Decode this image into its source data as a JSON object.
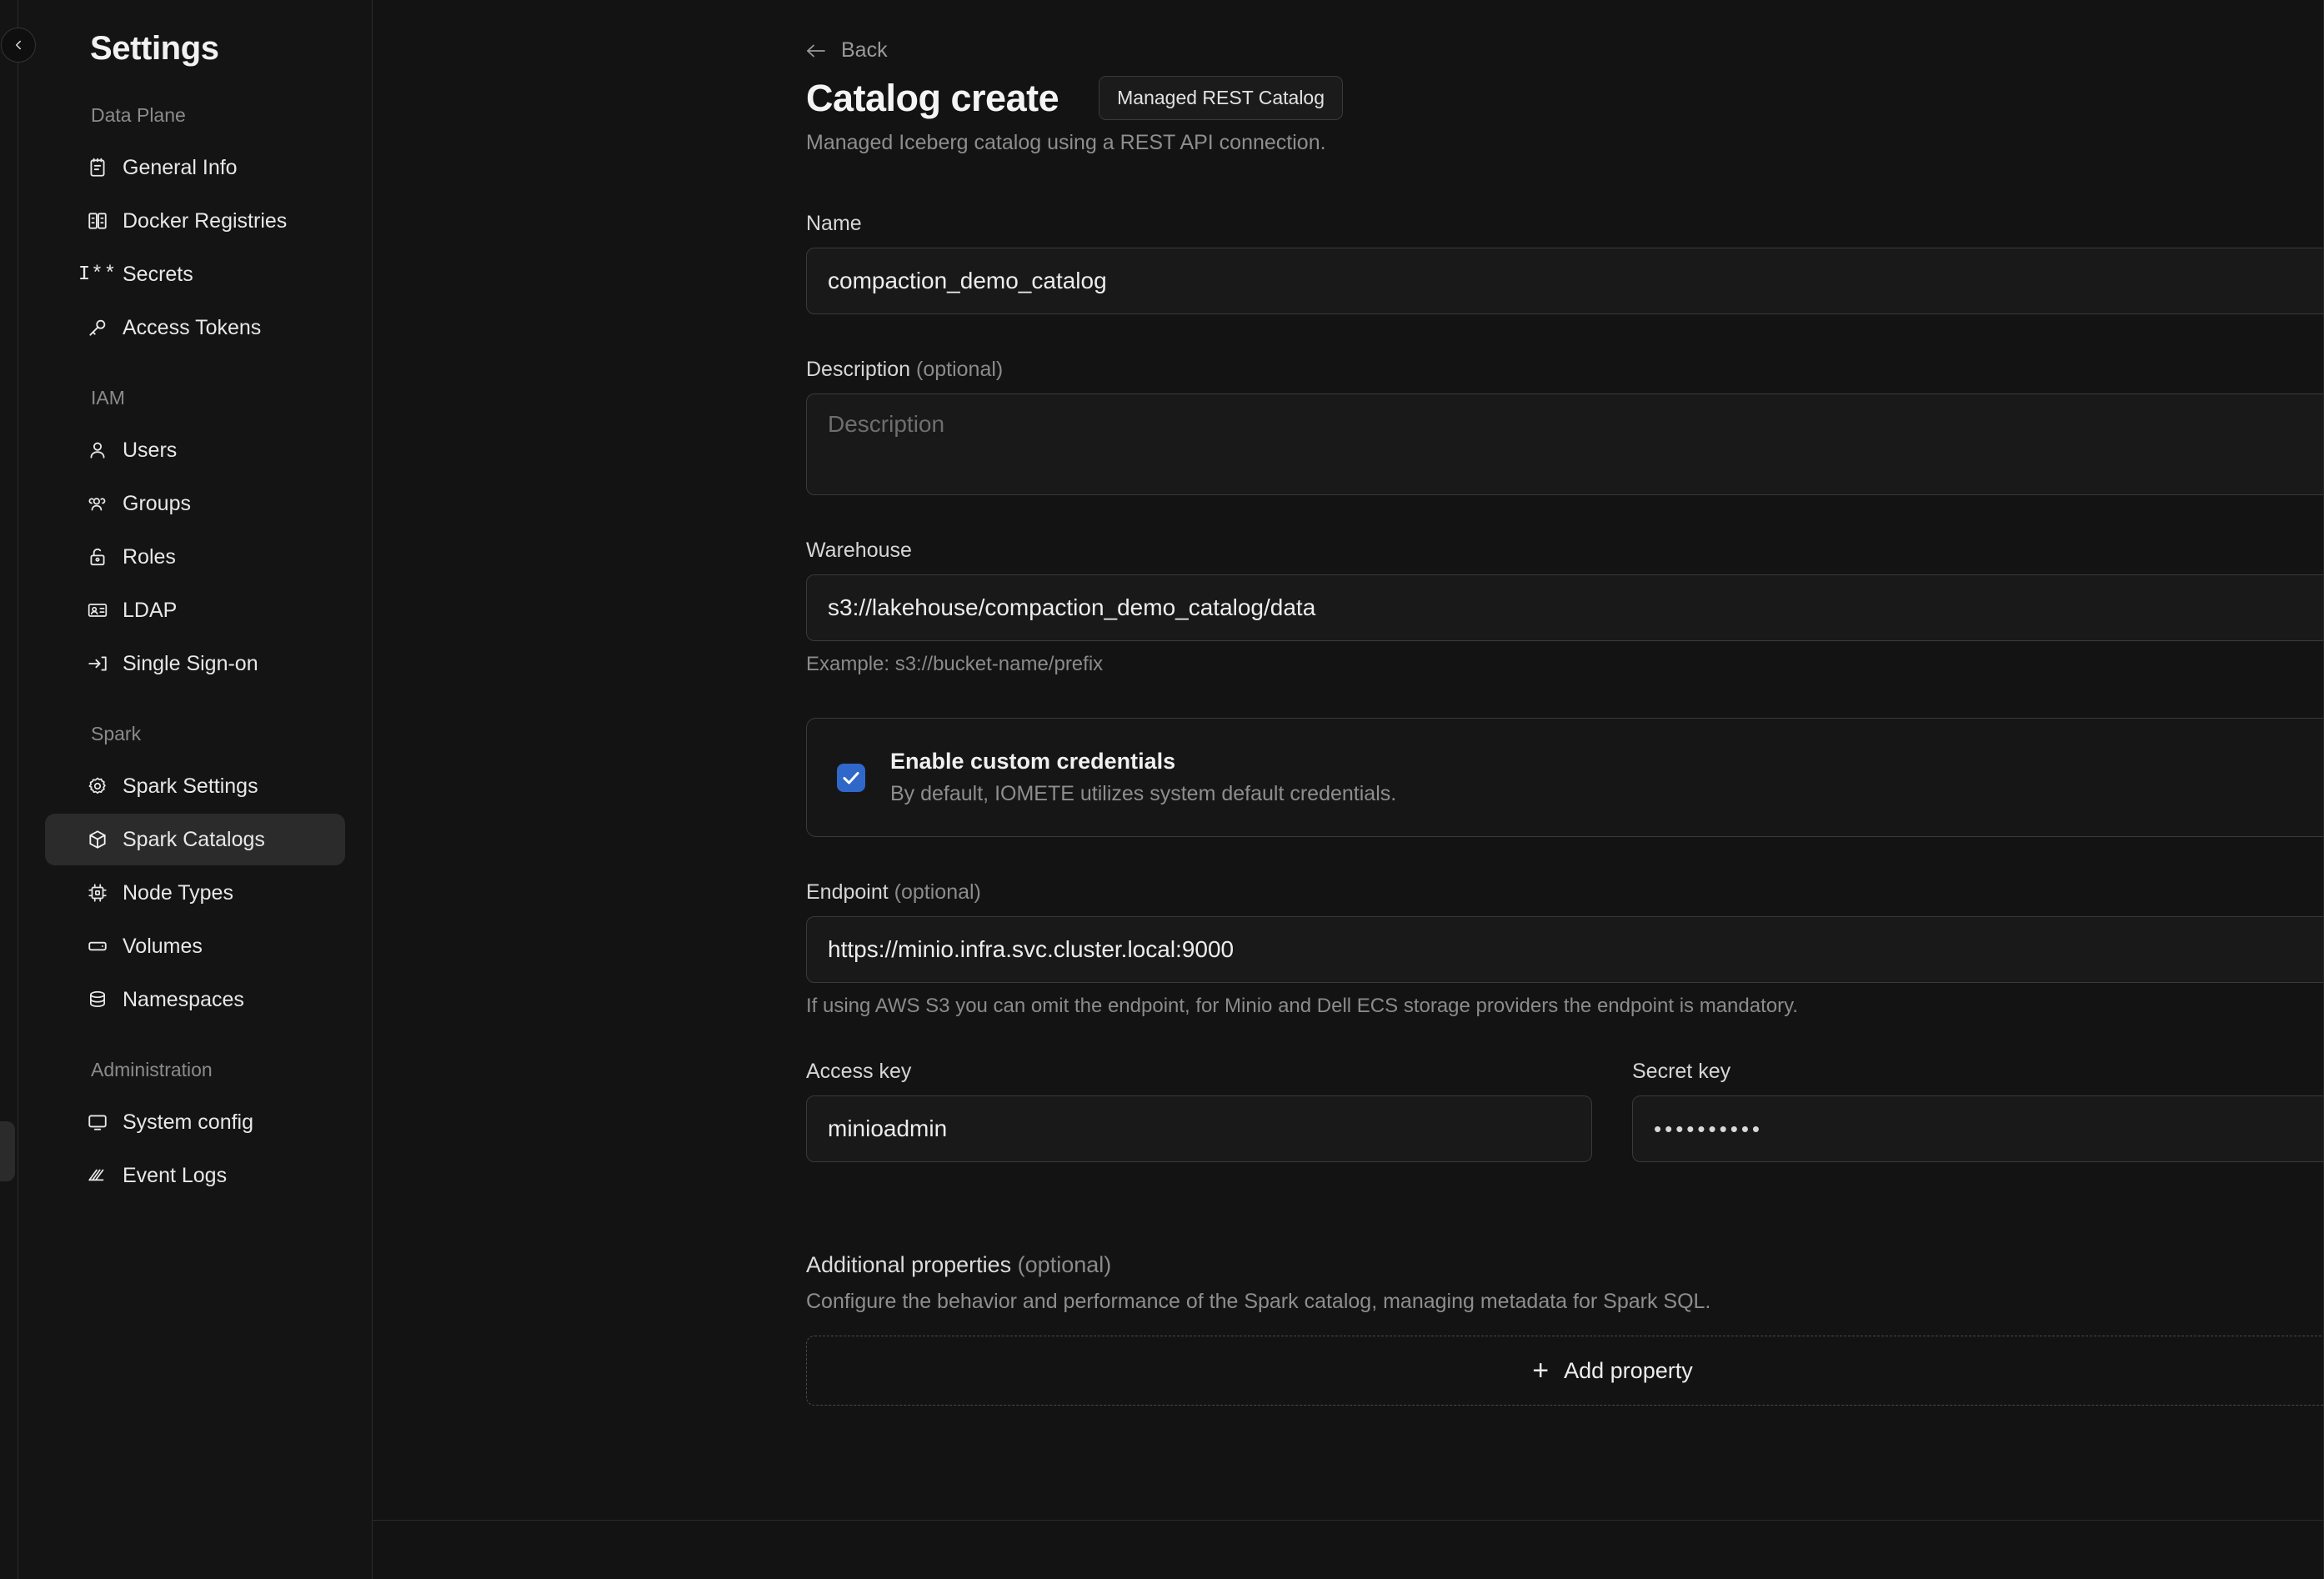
{
  "sidebar": {
    "title": "Settings",
    "collapse_icon": "chevron-left-icon",
    "sections": [
      {
        "heading": "Data Plane",
        "items": [
          {
            "label": "General Info",
            "icon": "notepad-icon"
          },
          {
            "label": "Docker Registries",
            "icon": "registry-icon"
          },
          {
            "label": "Secrets",
            "icon": "secrets-icon"
          },
          {
            "label": "Access Tokens",
            "icon": "key-icon"
          }
        ]
      },
      {
        "heading": "IAM",
        "items": [
          {
            "label": "Users",
            "icon": "user-icon"
          },
          {
            "label": "Groups",
            "icon": "users-group-icon"
          },
          {
            "label": "Roles",
            "icon": "lock-icon"
          },
          {
            "label": "LDAP",
            "icon": "id-card-icon"
          },
          {
            "label": "Single Sign-on",
            "icon": "login-arrow-icon"
          }
        ]
      },
      {
        "heading": "Spark",
        "items": [
          {
            "label": "Spark Settings",
            "icon": "gear-icon"
          },
          {
            "label": "Spark Catalogs",
            "icon": "cube-icon",
            "active": true
          },
          {
            "label": "Node Types",
            "icon": "cpu-icon"
          },
          {
            "label": "Volumes",
            "icon": "volume-icon"
          },
          {
            "label": "Namespaces",
            "icon": "database-icon"
          }
        ]
      },
      {
        "heading": "Administration",
        "items": [
          {
            "label": "System config",
            "icon": "monitor-icon"
          },
          {
            "label": "Event Logs",
            "icon": "logs-icon"
          }
        ]
      }
    ]
  },
  "header": {
    "back_label": "Back",
    "back_icon": "arrow-left-icon",
    "title": "Catalog create",
    "badge": "Managed REST Catalog",
    "subtitle": "Managed Iceberg catalog using a REST API connection."
  },
  "form": {
    "name": {
      "label": "Name",
      "value": "compaction_demo_catalog"
    },
    "description": {
      "label": "Description",
      "optional": "(optional)",
      "value": "",
      "placeholder": "Description"
    },
    "warehouse": {
      "label": "Warehouse",
      "value": "s3://lakehouse/compaction_demo_catalog/data",
      "hint": "Example: s3://bucket-name/prefix"
    },
    "credentials": {
      "checked": true,
      "title": "Enable custom credentials",
      "subtitle": "By default, IOMETE utilizes system default credentials."
    },
    "endpoint": {
      "label": "Endpoint",
      "optional": "(optional)",
      "value": "https://minio.infra.svc.cluster.local:9000",
      "hint": "If using AWS S3 you can omit the endpoint, for Minio and Dell ECS storage providers the endpoint is mandatory."
    },
    "access_key": {
      "label": "Access key",
      "value": "minioadmin"
    },
    "secret_key": {
      "label": "Secret key",
      "value": "••••••••••"
    },
    "additional_properties": {
      "label": "Additional properties",
      "optional": "(optional)",
      "description": "Configure the behavior and performance of the Spark catalog, managing metadata for Spark SQL.",
      "add_label": "Add property",
      "add_icon": "plus-icon"
    }
  },
  "colors": {
    "accent": "#2f68c9",
    "background": "#131313",
    "sidebar": "#141414",
    "border": "#2a2a2a",
    "active_item": "#2b2b2b"
  }
}
